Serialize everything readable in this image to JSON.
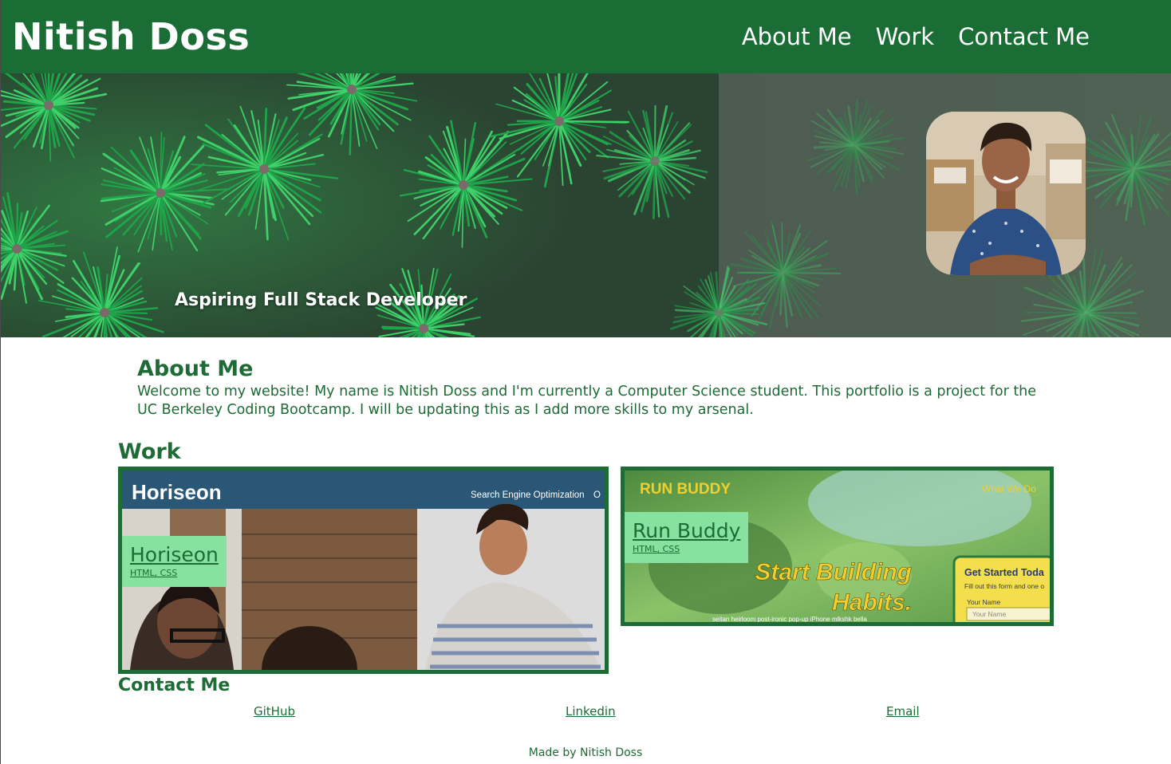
{
  "header": {
    "site_title": "Nitish Doss",
    "nav": [
      "About Me",
      "Work",
      "Contact Me"
    ]
  },
  "hero": {
    "tagline": "Aspiring Full Stack Developer"
  },
  "about": {
    "heading": "About Me",
    "body": "Welcome to my website! My name is Nitish Doss and I'm currently a Computer Science student. This portfolio is a project for the UC Berkeley Coding Bootcamp. I will be updating this as I add more skills to my arsenal."
  },
  "work": {
    "heading": "Work",
    "projects": [
      {
        "title": "Horiseon",
        "tech": "HTML, CSS",
        "screenshot": {
          "brand": "Horiseon",
          "nav": "Search Engine Optimization",
          "nav_more": "O"
        }
      },
      {
        "title": "Run Buddy",
        "tech": "HTML, CSS",
        "screenshot": {
          "brand": "RUN BUDDY",
          "nav": "What We Do",
          "headline_1": "Start Building",
          "headline_2": "Habits.",
          "form_title": "Get Started Toda",
          "form_sub": "Fill out this form and one o",
          "field_label": "Your Name",
          "field_placeholder": "Your Name",
          "footer_text": "seitan heirloom post-ironic pop-up iPhone mlkshk bella"
        }
      }
    ]
  },
  "contact": {
    "heading": "Contact Me",
    "links": [
      "GitHub",
      "Linkedin",
      "Email"
    ]
  },
  "footer": {
    "text": "Made by Nitish Doss"
  },
  "colors": {
    "header_bg": "#1a6e35",
    "text_green": "#1d6b35",
    "label_bg": "#88e29f"
  }
}
